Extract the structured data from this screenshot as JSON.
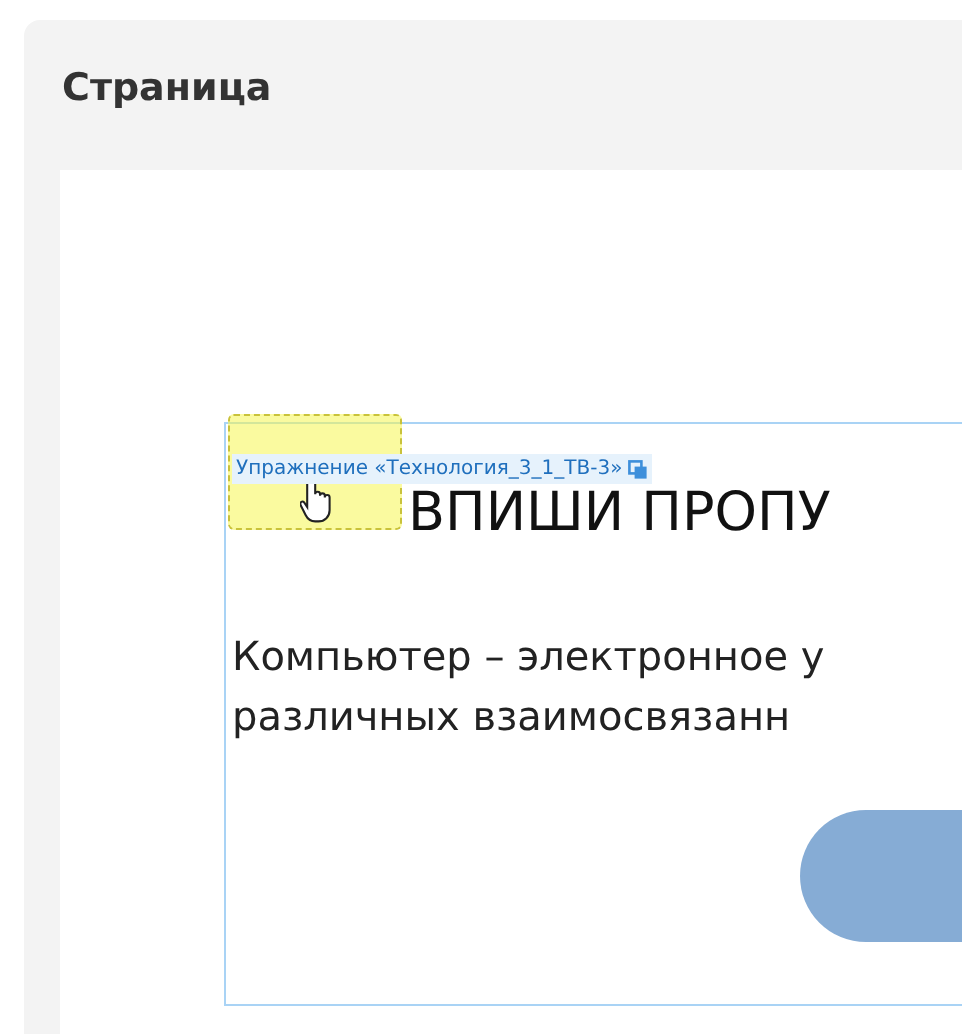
{
  "page": {
    "title": "Страница"
  },
  "exercise": {
    "label": "Упражнение «Технология_3_1_ТВ-3»",
    "heading": "ВПИШИ ПРОПУ",
    "paragraph_lines": [
      "Компьютер – электронное у",
      "различных взаимосвязанн"
    ]
  }
}
